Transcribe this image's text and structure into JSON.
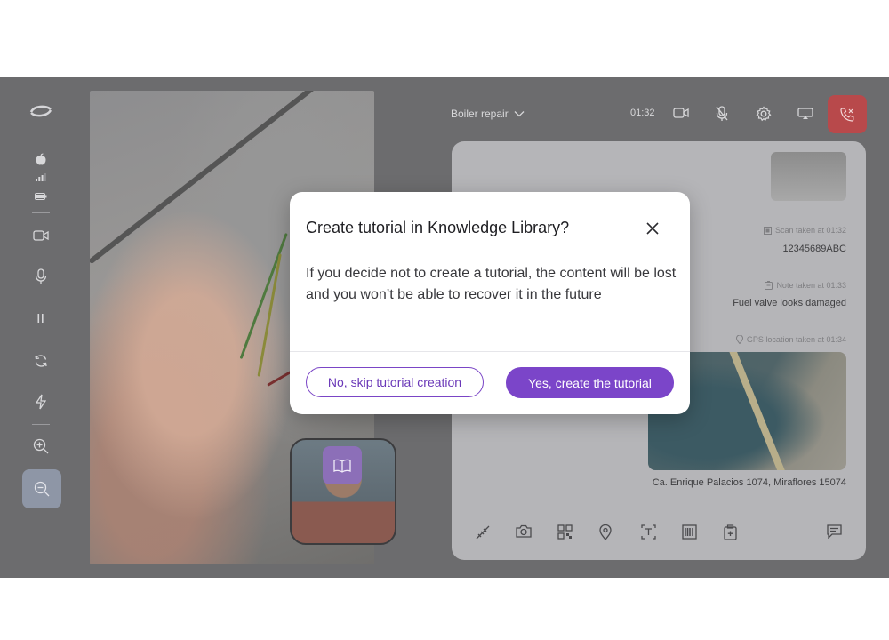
{
  "rail": {
    "icons": [
      "logo-icon",
      "apple-icon",
      "signal-icon",
      "battery-icon",
      "camera-icon",
      "microphone-icon",
      "pause-icon",
      "refresh-icon",
      "flash-icon",
      "zoom-in-icon",
      "zoom-out-icon"
    ]
  },
  "topbar": {
    "title": "Boiler repair",
    "timer": "01:32"
  },
  "panel": {
    "entries": [
      {
        "meta": "Scan taken at 01:32",
        "value": "12345689ABC"
      },
      {
        "meta": "Note taken at 01:33",
        "value": "Fuel valve looks damaged"
      },
      {
        "meta": "GPS location taken at 01:34",
        "value": "Ca. Enrique Palacios 1074, Miraflores 15074"
      }
    ]
  },
  "dialog": {
    "title": "Create tutorial in Knowledge Library?",
    "body": "If you decide not to create a tutorial, the content will be lost and you won’t be able to recover it in the future",
    "secondary_label": "No, skip tutorial creation",
    "primary_label": "Yes, create the tutorial"
  },
  "colors": {
    "accent": "#7b45c9",
    "end_call": "#b8494b",
    "overlay": "#6c6c6e"
  }
}
